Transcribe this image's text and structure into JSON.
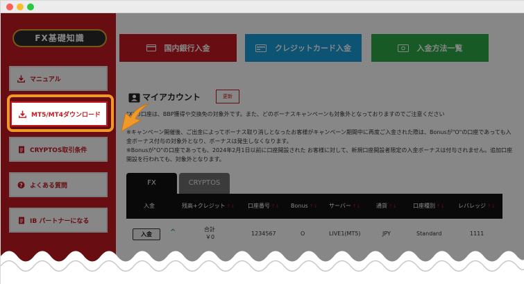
{
  "sidebar": {
    "title": "FX基礎知識",
    "items": [
      {
        "label": "マニュアル",
        "icon": "download-icon"
      },
      {
        "label": "MT5/MT4ダウンロード",
        "icon": "download-icon"
      },
      {
        "label": "CRYPTOS取引条件",
        "icon": "document-icon"
      },
      {
        "label": "よくある質問",
        "icon": "question-icon"
      },
      {
        "label": "IB パートナーになる",
        "icon": "document-icon"
      }
    ]
  },
  "top_buttons": {
    "bank": "国内銀行入金",
    "card": "クレジットカード入金",
    "methods": "入金方法一覧"
  },
  "account": {
    "title": "マイアカウント",
    "renew_label": "更新",
    "notice1": "\"X\"の口座は、BBP獲得や交換免の対象外です。また、どのボーナスキャンペーンも対象外となっておりますのでご注意ください",
    "notice2": "※キャンペーン開催後、ご出金によってボーナス取り消しとなったお客様がキャンペーン期間中に再度ご入金された際は、Bonusが\"O\"の口座であっても入金ボーナス付与の対象外となり、ボーナスは発生しなくなります。",
    "notice3": "※Bonusが\"O\"の口座であっても、2024年2月1日以前に口座開設された お客様に対して、新規口座開設者限定の入金ボーナスは付与されません。追加口座開設を行われても、対象外となります。"
  },
  "tabs": [
    "FX",
    "CRYPTOS"
  ],
  "table": {
    "headers": [
      "入金",
      "残高+クレジット",
      "口座番号",
      "Bonus",
      "サーバー",
      "通貨",
      "口座種別",
      "レバレッジ"
    ],
    "sort_glyph": "↑↓",
    "row": {
      "deposit_label": "入金",
      "expand_glyph": "^",
      "balance_label": "合計",
      "balance_value": "￥0",
      "account_number": "1234567",
      "bonus": "O",
      "server": "LIVE1(MT5)",
      "currency": "JPY",
      "account_type": "Standard",
      "leverage": "1111"
    }
  },
  "colors": {
    "brand_red": "#c41a22",
    "blue": "#1a9dd9",
    "green": "#2eaa47",
    "highlight_orange": "#f0982a"
  }
}
